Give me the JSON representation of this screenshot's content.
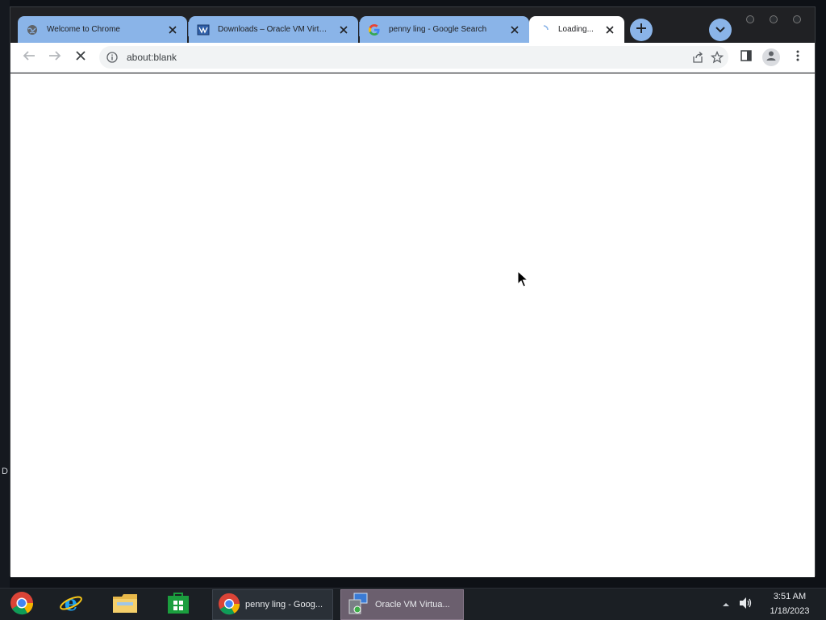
{
  "desktop": {
    "edge_letter": "D"
  },
  "browser": {
    "tabs": [
      {
        "title": "Welcome to Chrome",
        "favicon": "globe-icon",
        "active": false
      },
      {
        "title": "Downloads – Oracle VM VirtualBox",
        "favicon": "virtualbox-icon",
        "active": false
      },
      {
        "title": "penny ling - Google Search",
        "favicon": "google-icon",
        "active": false
      },
      {
        "title": "Loading...",
        "favicon": "spinner-icon",
        "active": true
      }
    ],
    "address": {
      "url": "about:blank"
    }
  },
  "colors": {
    "tab_inactive": "#8ab4e8",
    "tab_active": "#ffffff",
    "taskbar_bg": "#1b1f24",
    "active_task": "#6b5f6e"
  },
  "taskbar": {
    "pinned": [
      "chrome-icon",
      "internet-explorer-icon",
      "file-explorer-icon",
      "store-icon"
    ],
    "tasks": [
      {
        "label": "penny ling - Goog...",
        "icon": "chrome-icon",
        "active": false
      },
      {
        "label": "Oracle VM Virtua...",
        "icon": "virtualbox-icon",
        "active": true
      }
    ],
    "clock": {
      "time": "3:51 AM",
      "date": "1/18/2023"
    }
  }
}
